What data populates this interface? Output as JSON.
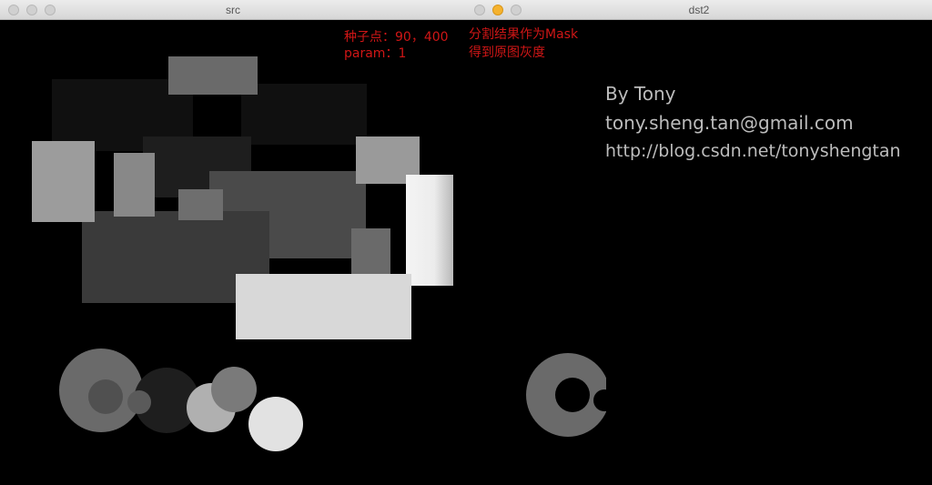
{
  "windows": {
    "src": {
      "title": "src"
    },
    "dst": {
      "title": "dst2"
    }
  },
  "annotations": {
    "seed_label": "种子点：90，400",
    "param_label": "param：1",
    "mask_label": "分割结果作为Mask",
    "gray_label": "得到原图灰度"
  },
  "credits": {
    "author": "By Tony",
    "email": "tony.sheng.tan@gmail.com",
    "blog": "http://blog.csdn.net/tonyshengtan"
  },
  "colors": {
    "background": "#000000",
    "annotation": "#d01616",
    "credit_text": "#bcbcbc",
    "traffic_light_active": "#f5b22e"
  }
}
